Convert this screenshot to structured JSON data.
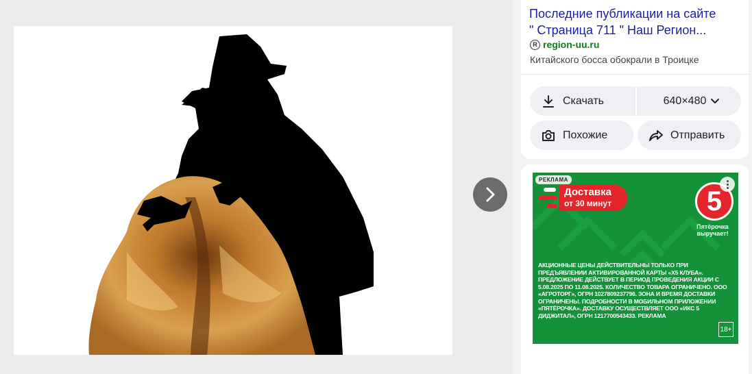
{
  "result": {
    "title_line1": "Последние публикации на сайте",
    "title_line2": "\" Страница 711 \" Наш Регион...",
    "site_name": "region-uu.ru",
    "site_icon_letter": "R",
    "snippet": "Китайского босса обокрали в Троицке"
  },
  "actions": {
    "download_label": "Скачать",
    "size_label": "640×480",
    "similar_label": "Похожие",
    "share_label": "Отправить"
  },
  "viewer": {
    "image_description_icon": "silhouette-fur-coat-image",
    "next_icon": "chevron-right-icon"
  },
  "ad": {
    "badge": "РЕКЛАМА",
    "promo_line1": "Доставка",
    "promo_line2": "от 30 минут",
    "logo_text": "5",
    "slogan": "Пятёрочка выручает!",
    "legal": "Акционные цены действительны только при предъявлении активированной карты «Х5 Клуба». Предложение действует в период проведения акции с 5.08.2025 по 11.08.2025. Количество товара ограничено. ООО «Агроторг», ОГРН 1027809237796. Зона и время доставки ограничены. Подробности в мобильном приложении «Пятёрочка». Доставку осуществляет ООО «ИКС 5 Диджитал», ОГРН 1217700543433. Реклама",
    "age": "18+",
    "brand_green": "#15913a",
    "brand_red": "#e4252b"
  },
  "colors": {
    "title_link": "#1d1d9e",
    "site_green": "#0a7a1e",
    "button_bg": "#eef0f3"
  }
}
